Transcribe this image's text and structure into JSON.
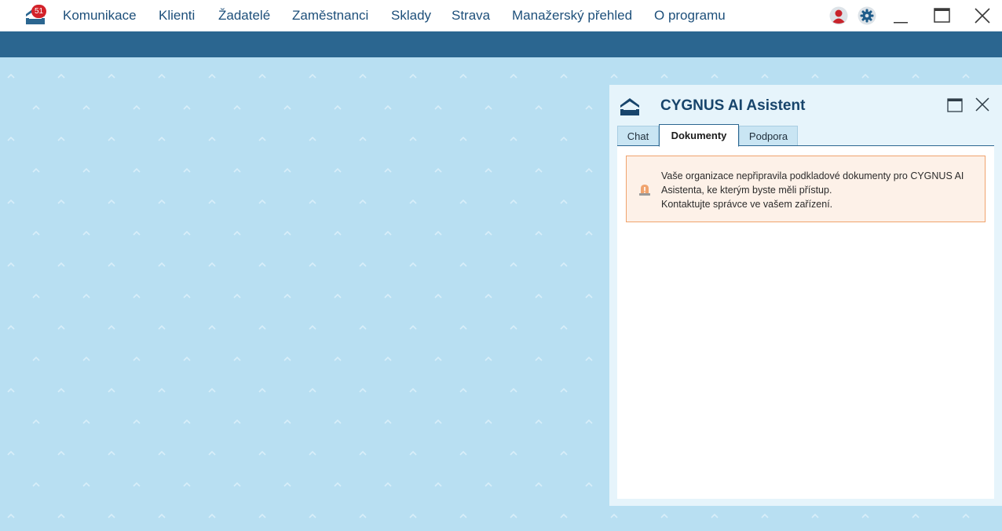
{
  "app": {
    "notification_count": "51",
    "colors": {
      "accent": "#2b6690",
      "background": "#b8dff2",
      "badge": "#d3222a",
      "warning_border": "#f0a36d"
    }
  },
  "nav": {
    "items": [
      {
        "label": "Komunikace"
      },
      {
        "label": "Klienti"
      },
      {
        "label": "Žadatelé"
      },
      {
        "label": "Zaměstnanci"
      },
      {
        "label": "Sklady"
      },
      {
        "label": "Strava"
      },
      {
        "label": "Manažerský přehled"
      },
      {
        "label": "O programu"
      }
    ]
  },
  "window_controls": [
    "user-icon",
    "gear-icon",
    "minimize-icon",
    "maximize-icon",
    "close-icon"
  ],
  "assistant": {
    "title": "CYGNUS AI Asistent",
    "tabs": [
      {
        "label": "Chat",
        "active": false
      },
      {
        "label": "Dokumenty",
        "active": true
      },
      {
        "label": "Podpora",
        "active": false
      }
    ],
    "alert": {
      "icon": "warning-icon",
      "line1": "Vaše organizace nepřipravila podkladové dokumenty pro CYGNUS AI Asistenta, ke kterým byste měli přístup.",
      "line2": "Kontaktujte správce ve vašem zařízení."
    }
  }
}
